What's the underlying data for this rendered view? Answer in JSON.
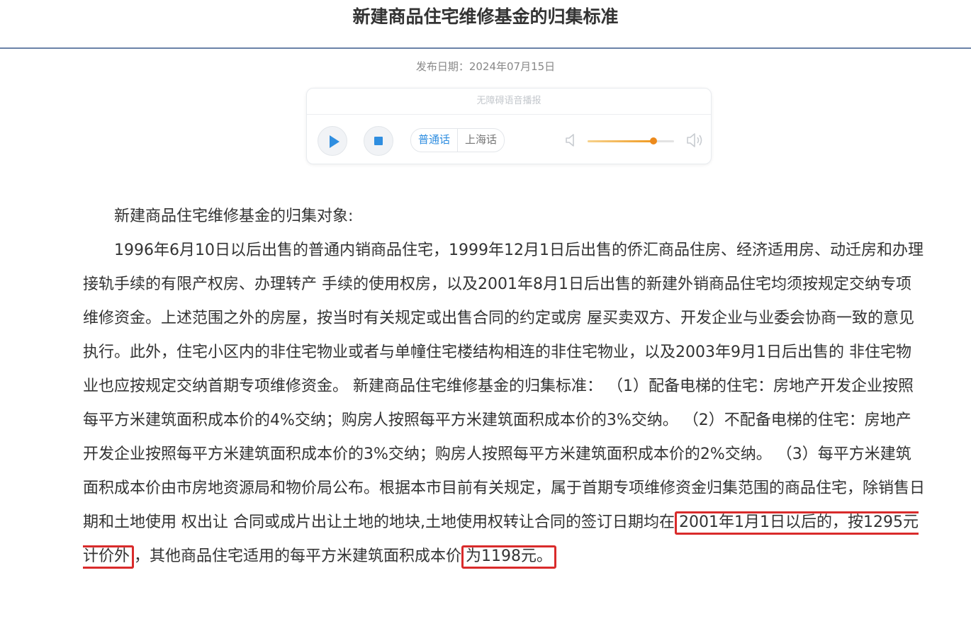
{
  "page": {
    "title": "新建商品住宅维修基金的归集标准",
    "publish_date": "发布日期：2024年07月15日"
  },
  "audio_player": {
    "header": "无障碍语音播报",
    "languages": [
      "普通话",
      "上海话"
    ],
    "selected_language": "普通话",
    "volume_level": 0.76,
    "accent_color": "#2f8ee0",
    "volume_color": "#ef9a22"
  },
  "article": {
    "heading": "新建商品住宅维修基金的归集对象:",
    "body_before": "1996年6月10日以后出售的普通内销商品住宅，1999年12月1日后出售的侨汇商品住房、经济适用房、动迁房和办理接轨手续的有限产权房、办理转产 手续的使用权房，以及2001年8月1日后出售的新建外销商品住宅均须按规定交纳专项维修资金。上述范围之外的房屋，按当时有关规定或出售合同的约定或房 屋买卖双方、开发企业与业委会协商一致的意见执行。此外，住宅小区内的非住宅物业或者与单幢住宅楼结构相连的非住宅物业，以及2003年9月1日后出售的 非住宅物业也应按规定交纳首期专项维修资金。 新建商品住宅维修基金的归集标准： （1）配备电梯的住宅：房地产开发企业按照每平方米建筑面积成本价的4%交纳；购房人按照每平方米建筑面积成本价的3%交纳。 （2）不配备电梯的住宅：房地产开发企业按照每平方米建筑面积成本价的3%交纳；购房人按照每平方米建筑面积成本价的2%交纳。 （3）每平方米建筑面积成本价由市房地资源局和物价局公布。根据本市目前有关规定，属于首期专项维修资金归集范围的商品住宅，除销售日期和土地使用 权出让 合同或成片出让土地的地块,土地使用权转让合同的签订日期均在",
    "highlight_1": "2001年1月1日以后的，按1295元计价外",
    "body_middle": "，其他商品住宅适用的每平方米建筑面积成本价",
    "highlight_2": "为1198元。",
    "highlight_color": "#d92b2b"
  }
}
